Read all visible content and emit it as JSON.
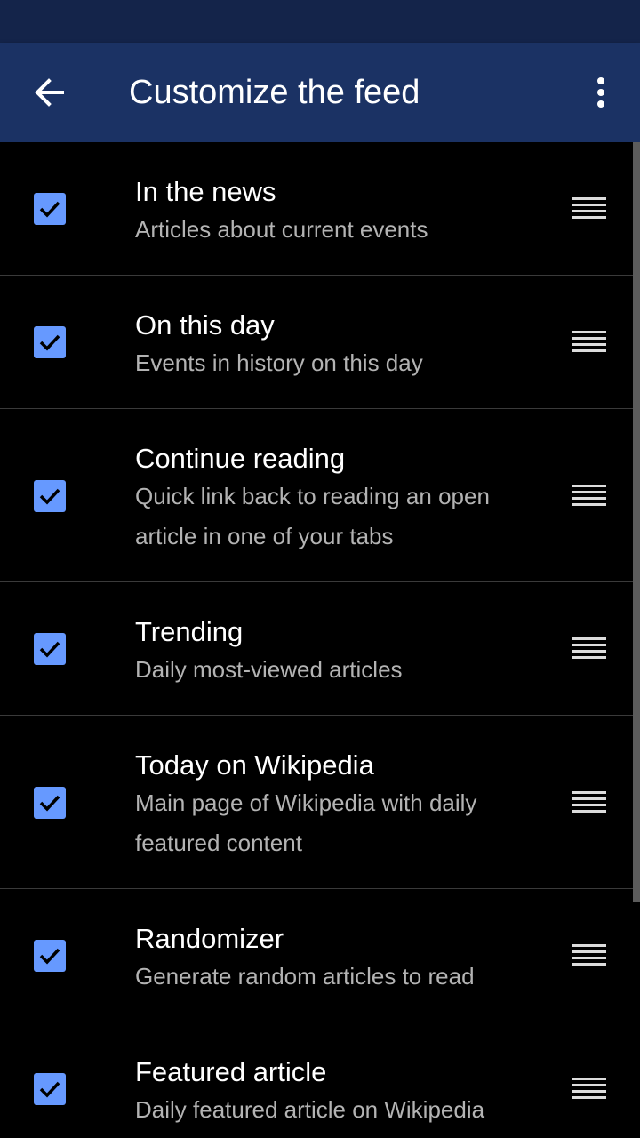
{
  "header": {
    "title": "Customize the feed",
    "back_icon": "arrow-left-icon",
    "menu_icon": "more-vertical-icon"
  },
  "colors": {
    "status_bar": "#14244a",
    "app_bar": "#1b3264",
    "checkbox": "#6699ff",
    "background": "#000000",
    "secondary_text": "#b3b3b3"
  },
  "feed_items": [
    {
      "title": "In the news",
      "description": "Articles about current events",
      "checked": true
    },
    {
      "title": "On this day",
      "description": "Events in history on this day",
      "checked": true
    },
    {
      "title": "Continue reading",
      "description": "Quick link back to reading an open article in one of your tabs",
      "checked": true
    },
    {
      "title": "Trending",
      "description": "Daily most-viewed articles",
      "checked": true
    },
    {
      "title": "Today on Wikipedia",
      "description": "Main page of Wikipedia with daily featured content",
      "checked": true
    },
    {
      "title": "Randomizer",
      "description": "Generate random articles to read",
      "checked": true
    },
    {
      "title": "Featured article",
      "description": "Daily featured article on Wikipedia",
      "checked": true
    }
  ]
}
